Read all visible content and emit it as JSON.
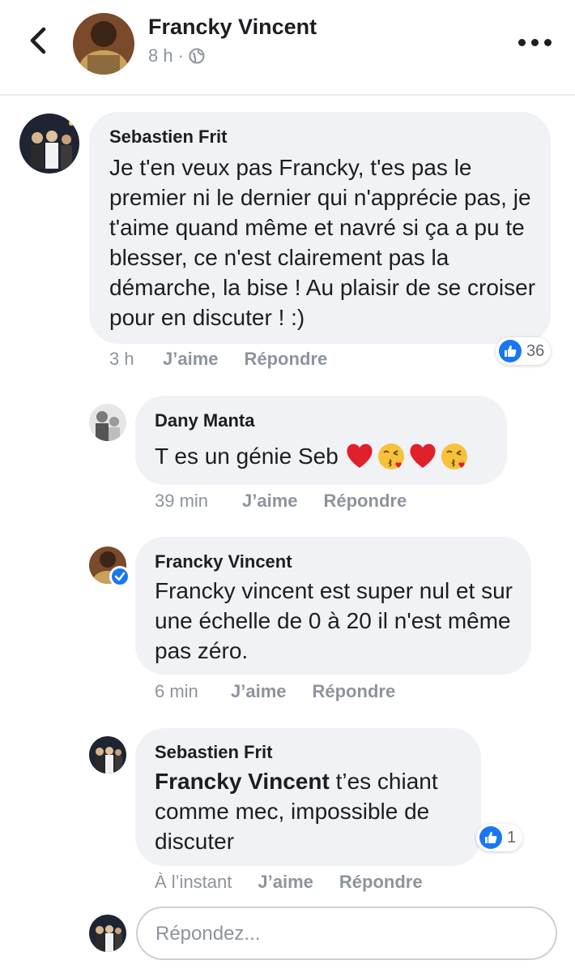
{
  "header": {
    "name": "Francky Vincent",
    "time": "8 h",
    "separator": "·",
    "privacy_icon": "globe-icon",
    "back_icon": "back-arrow-icon",
    "more_icon": "more-options-icon"
  },
  "comments": [
    {
      "author": "Sebastien Frit",
      "text": "Je t'en veux pas Francky, t'es pas le premier ni le dernier qui n'apprécie pas, je t'aime quand même et navré si ça a pu te blesser, ce n'est clairement pas la démarche, la bise ! Au plaisir de se croiser pour en discuter ! :)",
      "time": "3 h",
      "like_label": "J’aime",
      "reply_label": "Répondre",
      "reaction_count": "36"
    },
    {
      "author": "Dany Manta",
      "text": "T es un génie Seb",
      "emojis": [
        "heart-emoji",
        "kiss-emoji",
        "heart-emoji",
        "kiss-emoji"
      ],
      "time": "39 min",
      "like_label": "J’aime",
      "reply_label": "Répondre"
    },
    {
      "author": "Francky Vincent",
      "text": "Francky vincent est super nul et sur une échelle de 0 à 20 il n'est même pas zéro.",
      "time": "6 min",
      "like_label": "J’aime",
      "reply_label": "Répondre",
      "verified": true
    },
    {
      "author": "Sebastien Frit",
      "mention": "Francky Vincent",
      "text": " t’es chiant comme mec, impossible de discuter",
      "time": "À l’instant",
      "like_label": "J’aime",
      "reply_label": "Répondre",
      "reaction_count": "1"
    }
  ],
  "reply_input": {
    "placeholder": "Répondez..."
  },
  "colors": {
    "bubble": "#f0f2f5",
    "like_blue": "#1877f2",
    "meta_gray": "#8d949e"
  }
}
